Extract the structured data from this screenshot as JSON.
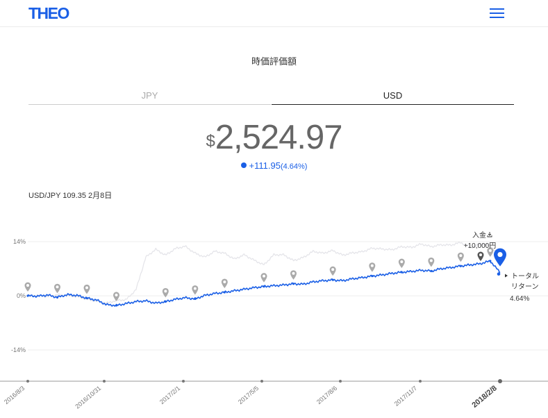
{
  "header": {
    "logo": "THEO",
    "menu_icon": "hamburger-icon"
  },
  "section_title": "時価評価額",
  "tabs": [
    {
      "label": "JPY",
      "active": false
    },
    {
      "label": "USD",
      "active": true
    }
  ],
  "valuation": {
    "currency_symbol": "$",
    "amount": "2,524.97",
    "change": "+111.95",
    "change_percent": "(4.64%)"
  },
  "exchange_rate": "USD/JPY 109.35   2月8日",
  "chart_labels": {
    "deposit_title": "入金",
    "deposit_amount": "+10,000円",
    "return_label_1": "トータル",
    "return_label_2": "リターン",
    "return_value": "4.64%"
  },
  "colors": {
    "accent": "#1a5fe6",
    "marker": "#aaaaaa",
    "benchmark": "#e3e3e8"
  },
  "chart_data": {
    "type": "line",
    "ylim": [
      -14,
      14
    ],
    "y_ticks": [
      "14%",
      "0%",
      "-14%"
    ],
    "x_ticks": [
      "2016/8/3",
      "2016/10/31",
      "2017/2/1",
      "2017/5/5",
      "2017/8/6",
      "2017/11/7",
      "2018/2/8"
    ],
    "series": [
      {
        "values": [
          0,
          -0.1,
          0.2,
          -0.4,
          0.3,
          0.1,
          -0.6,
          -1.1,
          -2.3,
          -2.5,
          -2.0,
          -1.5,
          -1.3,
          -1.9,
          -1.5,
          -0.9,
          -0.5,
          -0.8,
          0.1,
          0.6,
          0.9,
          1.3,
          1.7,
          2.1,
          2.4,
          2.6,
          2.8,
          3.1,
          3.0,
          3.6,
          3.9,
          4.1,
          3.9,
          4.4,
          4.7,
          5.1,
          5.4,
          5.8,
          6.1,
          6.3,
          6.6,
          6.4,
          7.0,
          7.3,
          7.7,
          8.0,
          8.3,
          9.0,
          6.0
        ]
      },
      {
        "values": [
          0,
          0.1,
          -0.2,
          0.3,
          0.0,
          -0.2,
          -0.9,
          -1.4,
          -1.9,
          -1.2,
          -1.0,
          1.6,
          10.0,
          12.0,
          10.5,
          12.2,
          12.8,
          11.0,
          10.0,
          11.5,
          11.0,
          9.5,
          10.6,
          9.2,
          8.0,
          10.6,
          10.6,
          9.1,
          9.9,
          11.5,
          11.0,
          11.7,
          10.5,
          11.1,
          11.4,
          12.3,
          12.1,
          11.9,
          12.7,
          12.5,
          13.4,
          12.7,
          13.2,
          13.1,
          13.8,
          12.4,
          13.4,
          13.0,
          10.0
        ]
      }
    ]
  }
}
